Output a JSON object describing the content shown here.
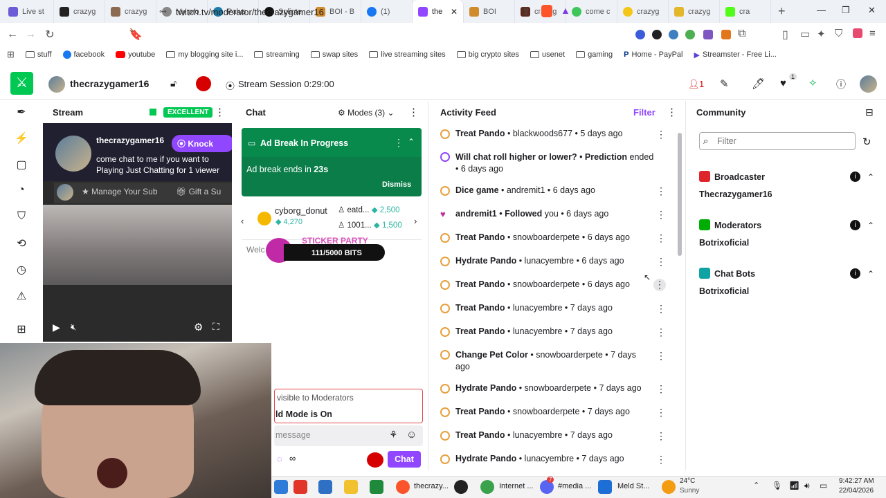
{
  "browser": {
    "tabs": [
      "Live st",
      "crazyg",
      "crazyg",
      "My pro",
      "Palus",
      "Splinte",
      "BOI - B",
      "(1)",
      "the",
      "BOI",
      "crazyg",
      "come c",
      "crazyg",
      "crazyg",
      "cra"
    ],
    "url": "twitch.tv/moderator/thecrazygamer16",
    "bookmarks": [
      "stuff",
      "facebook",
      "youtube",
      "my blogging site i...",
      "streaming",
      "swap sites",
      "live streaming sites",
      "big crypto sites",
      "usenet",
      "gaming",
      "Home - PayPal",
      "Streamster - Free Li..."
    ]
  },
  "topbar": {
    "channel": "thecrazygamer16",
    "session": "Stream Session 0:29:00",
    "viewer_count": "1",
    "notif_badge": "1"
  },
  "stream": {
    "title": "Stream",
    "health": "EXCELLENT",
    "overlay_name": "thecrazygamer16",
    "overlay_text": "come chat to me if you want to Playing Just Chatting for 1 viewer",
    "knock": "Knock",
    "manage_sub": "Manage Your Sub",
    "gift": "Gift a Su"
  },
  "chat": {
    "title": "Chat",
    "modes": "Modes (3)",
    "ad_title": "Ad Break In Progress",
    "ad_text": "Ad break ends in ",
    "ad_time": "23s",
    "dismiss": "Dismiss",
    "leader_name": "cyborg_donut",
    "leader_score": "4,270",
    "second_name": "eatd...",
    "second_score": "2,500",
    "third_name": "1001...",
    "third_score": "1,500",
    "welcome": "Welc",
    "sticker_title": "STICKER PARTY",
    "sticker_bits": "111/5000 BITS",
    "mod_notice": "visible to Moderators",
    "hold_mode": "ld Mode is On",
    "placeholder": "message",
    "infinity": "∞",
    "chat_btn": "Chat"
  },
  "feed": {
    "title": "Activity Feed",
    "filter": "Filter",
    "items": [
      {
        "bold": "Treat Pando",
        "rest": " • blackwoods677 • 5 days ago"
      },
      {
        "bold": "Will chat roll higher or lower? • Prediction",
        "rest": " ended • 6 days ago"
      },
      {
        "bold": "Dice game",
        "rest": " • andremit1 • 6 days ago"
      },
      {
        "bold": "andremit1 • Followed",
        "rest": " you • 6 days ago"
      },
      {
        "bold": "Treat Pando",
        "rest": " • snowboarderpete • 6 days ago"
      },
      {
        "bold": "Hydrate Pando",
        "rest": " • lunacyembre • 6 days ago"
      },
      {
        "bold": "Treat Pando",
        "rest": " • snowboarderpete • 6 days ago"
      },
      {
        "bold": "Treat Pando",
        "rest": " • lunacyembre • 7 days ago"
      },
      {
        "bold": "Treat Pando",
        "rest": " • lunacyembre • 7 days ago"
      },
      {
        "bold": "Change Pet Color",
        "rest": " • snowboarderpete • 7 days ago"
      },
      {
        "bold": "Hydrate Pando",
        "rest": " • snowboarderpete • 7 days ago"
      },
      {
        "bold": "Treat Pando",
        "rest": " • snowboarderpete • 7 days ago"
      },
      {
        "bold": "Treat Pando",
        "rest": " • lunacyembre • 7 days ago"
      },
      {
        "bold": "Hydrate Pando",
        "rest": " • lunacyembre • 7 days ago"
      }
    ]
  },
  "community": {
    "title": "Community",
    "placeholder": "Filter",
    "broadcaster_label": "Broadcaster",
    "broadcaster": "Thecrazygamer16",
    "moderators_label": "Moderators",
    "moderator": "Botrixoficial",
    "bots_label": "Chat Bots",
    "bot": "Botrixoficial"
  },
  "taskbar": {
    "app_label": "thecrazy...",
    "internet": "Internet ...",
    "media": "#media ...",
    "meld": "Meld St...",
    "temp": "24°C",
    "weather": "Sunny",
    "time": "9:42:27 AM",
    "date": "22/04/2026",
    "discord_badge": "7"
  },
  "colors": {
    "accent": "#00c853",
    "purple": "#9147ff",
    "feed_icon": "#e89f3c",
    "red": "#d70000"
  }
}
